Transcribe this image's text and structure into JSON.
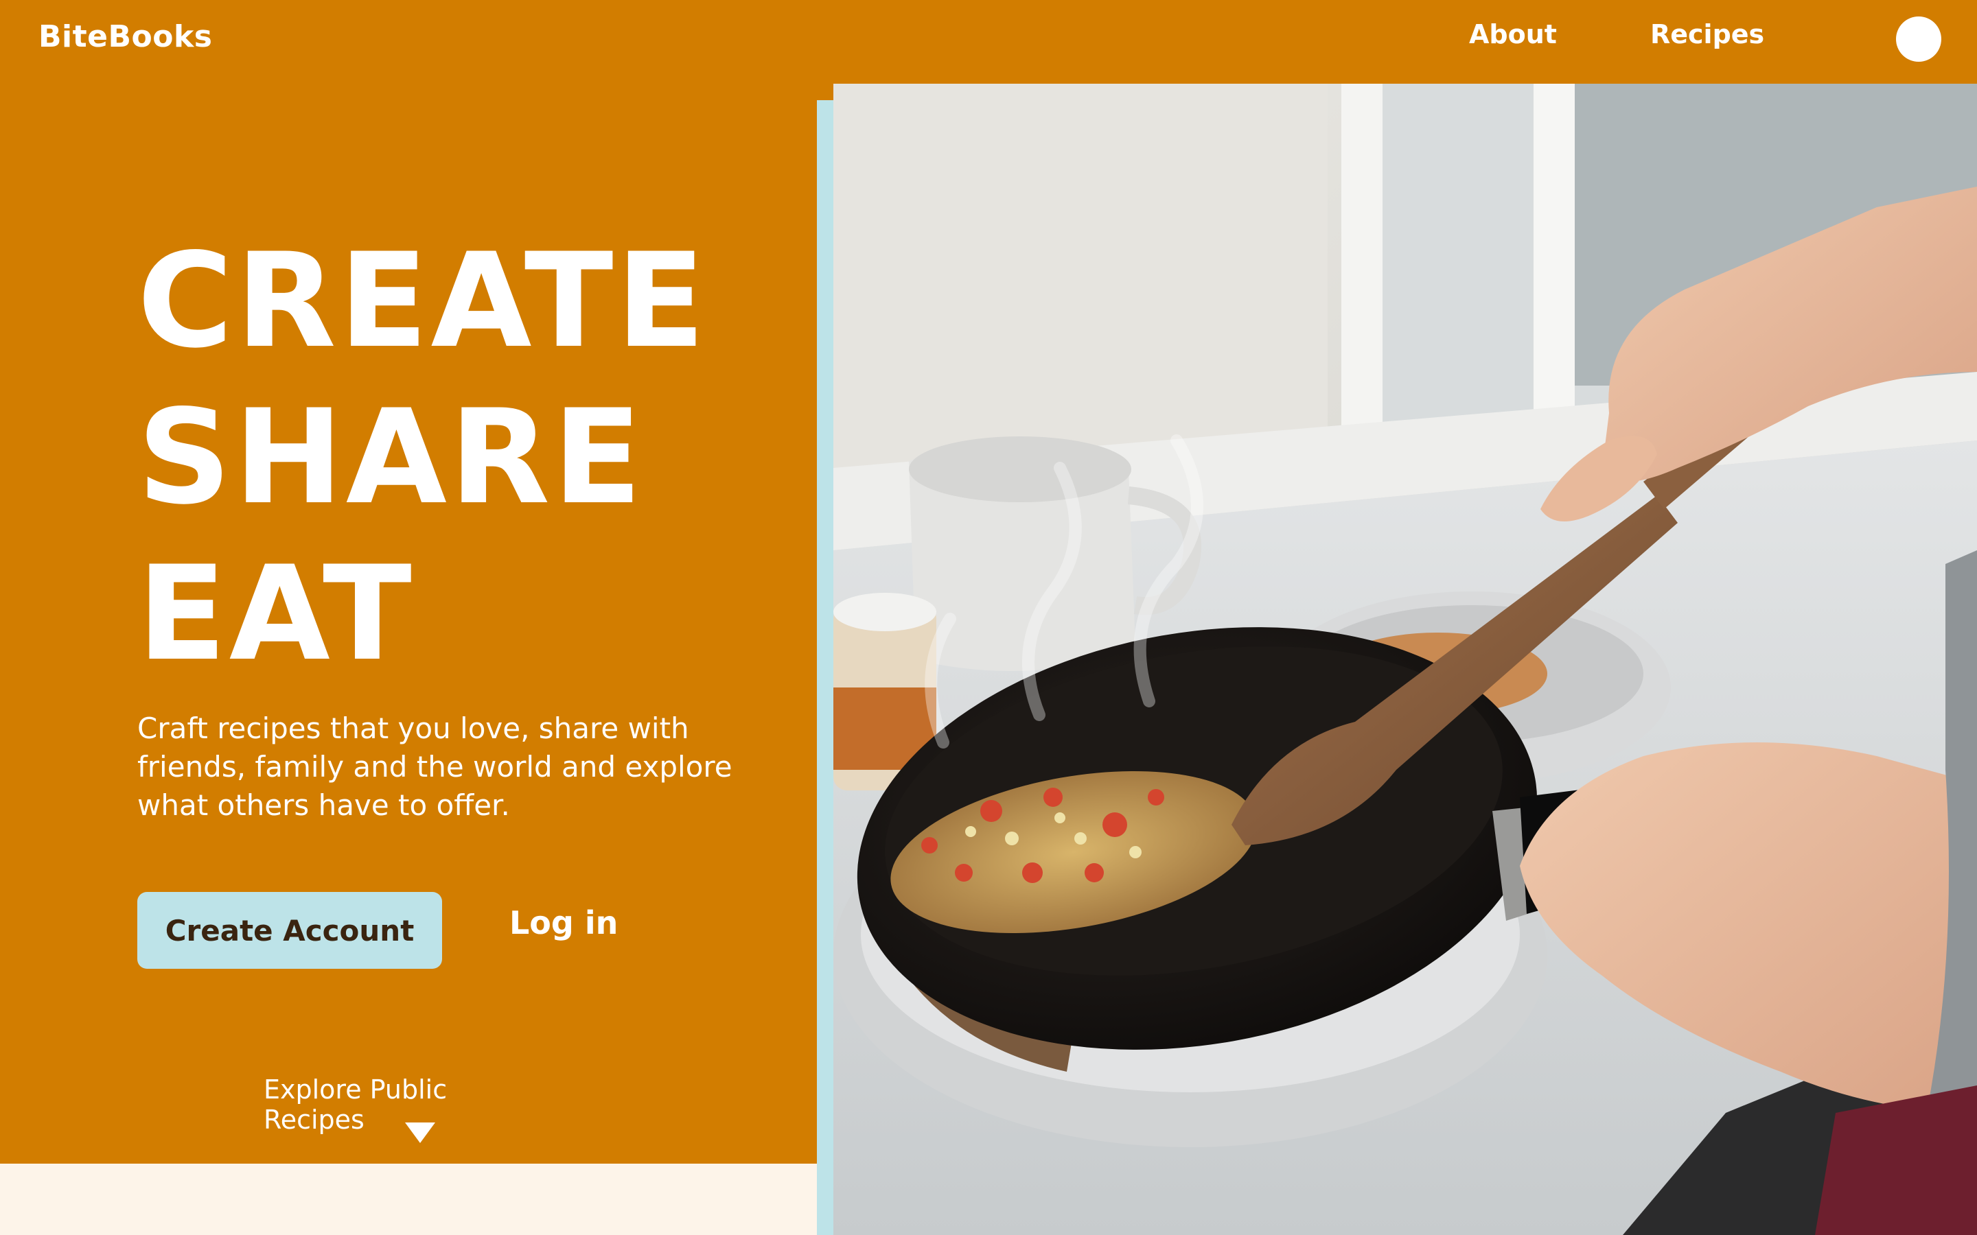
{
  "header": {
    "brand": "BiteBooks",
    "nav": [
      {
        "label": "About"
      },
      {
        "label": "Recipes"
      }
    ]
  },
  "hero": {
    "title_lines": [
      "CREATE",
      "SHARE",
      "EAT"
    ],
    "description": "Craft recipes that you love, share with friends, family and the world and explore what others have to offer.",
    "create_account_label": "Create Account",
    "login_label": "Log in",
    "explore_label": "Explore Public Recipes"
  },
  "colors": {
    "brand_orange": "#d27d00",
    "accent_blue": "#bde3e8",
    "button_text": "#3a2410",
    "cream": "#fdf4e9",
    "white": "#ffffff"
  },
  "icons": {
    "explore_arrow": "triangle-down-icon",
    "avatar": "user-avatar"
  }
}
